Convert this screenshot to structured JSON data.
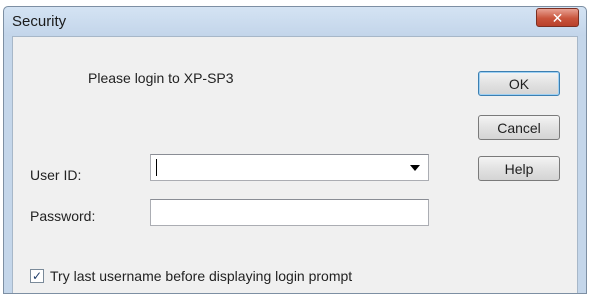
{
  "window": {
    "title": "Security",
    "close_glyph": "✕"
  },
  "prompt": "Please login to XP-SP3",
  "buttons": {
    "ok": "OK",
    "cancel": "Cancel",
    "help": "Help"
  },
  "user_id": {
    "label": "User ID:",
    "value": ""
  },
  "password": {
    "label": "Password:",
    "value": ""
  },
  "try_last": {
    "checked": true,
    "check_glyph": "✓",
    "label": "Try last username before displaying login prompt"
  },
  "icons": {
    "close": "close-icon",
    "dropdown": "chevron-down-icon",
    "check": "checkmark-icon"
  }
}
